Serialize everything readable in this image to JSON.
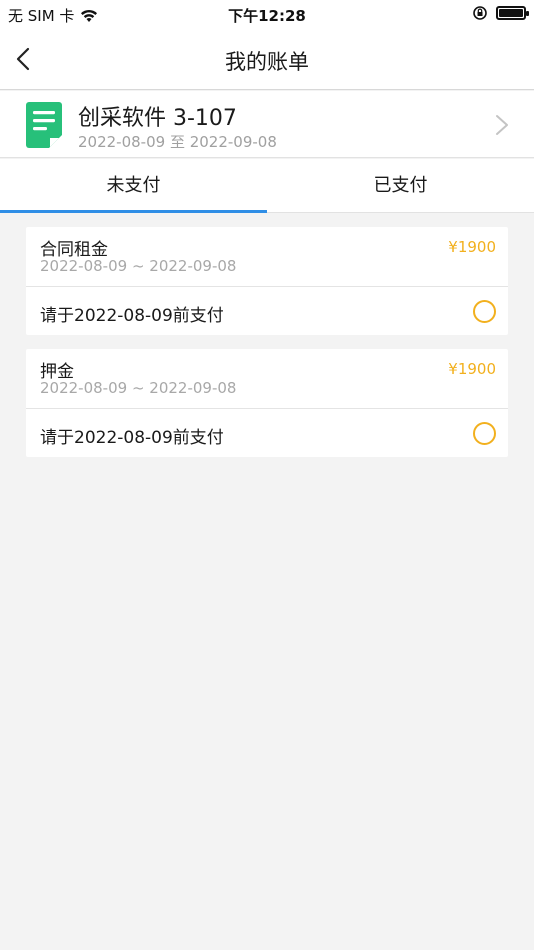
{
  "status_bar": {
    "carrier": "无 SIM 卡",
    "time": "下午12:28"
  },
  "nav": {
    "title": "我的账单"
  },
  "property": {
    "name": "创采软件 3-107",
    "range": "2022-08-09 至 2022-09-08",
    "icon_color": "#27c07a"
  },
  "tabs": {
    "unpaid": "未支付",
    "paid": "已支付",
    "active": "未支付",
    "accent_color": "#2f8ee6"
  },
  "bills": [
    {
      "title": "合同租金",
      "period": "2022-08-09 ~ 2022-09-08",
      "amount": "¥1900",
      "due": "请于2022-08-09前支付",
      "selected": false
    },
    {
      "title": "押金",
      "period": "2022-08-09 ~ 2022-09-08",
      "amount": "¥1900",
      "due": "请于2022-08-09前支付",
      "selected": false
    }
  ],
  "colors": {
    "amount": "#f2b01e",
    "background": "#f3f3f3"
  }
}
